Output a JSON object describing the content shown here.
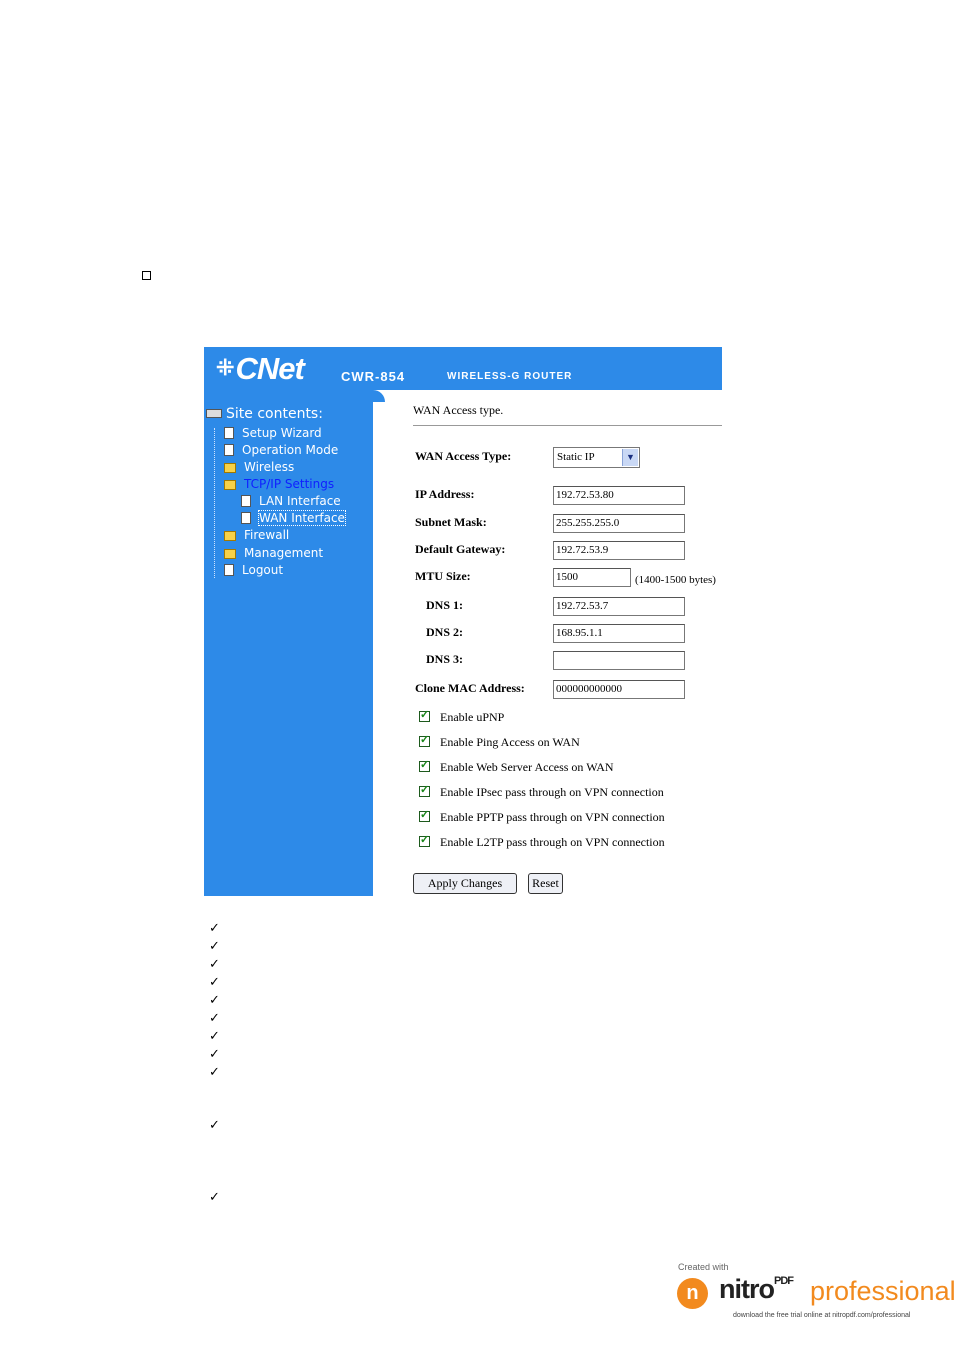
{
  "header": {
    "logo": "CNet",
    "model": "CWR-854",
    "product": "WIRELESS-G ROUTER"
  },
  "sidebar": {
    "root": "Site contents:",
    "items": [
      {
        "label": "Setup Wizard",
        "type": "doc"
      },
      {
        "label": "Operation Mode",
        "type": "doc"
      },
      {
        "label": "Wireless",
        "type": "folder"
      },
      {
        "label": "TCP/IP Settings",
        "type": "folder-open",
        "active": true
      },
      {
        "label": "LAN Interface",
        "type": "doc",
        "child": true
      },
      {
        "label": "WAN Interface",
        "type": "doc",
        "child": true
      },
      {
        "label": "Firewall",
        "type": "folder"
      },
      {
        "label": "Management",
        "type": "folder"
      },
      {
        "label": "Logout",
        "type": "doc"
      }
    ]
  },
  "form": {
    "section_title": "WAN Access type.",
    "wan_access_type_label": "WAN Access Type:",
    "wan_access_type_value": "Static IP",
    "ip_address_label": "IP Address:",
    "ip_address_value": "192.72.53.80",
    "subnet_mask_label": "Subnet Mask:",
    "subnet_mask_value": "255.255.255.0",
    "gateway_label": "Default Gateway:",
    "gateway_value": "192.72.53.9",
    "mtu_label": "MTU Size:",
    "mtu_value": "1500",
    "mtu_hint": "(1400-1500 bytes)",
    "dns1_label": "DNS 1:",
    "dns1_value": "192.72.53.7",
    "dns2_label": "DNS 2:",
    "dns2_value": "168.95.1.1",
    "dns3_label": "DNS 3:",
    "dns3_value": "",
    "clone_mac_label": "Clone MAC Address:",
    "clone_mac_value": "000000000000",
    "checkboxes": [
      "Enable uPNP",
      "Enable Ping Access on WAN",
      "Enable Web Server Access on WAN",
      "Enable IPsec pass through on VPN connection",
      "Enable PPTP pass through on VPN connection",
      "Enable L2TP pass through on VPN connection"
    ],
    "apply_label": "Apply Changes",
    "reset_label": "Reset"
  },
  "footer": {
    "created_with": "Created with",
    "brand": "nitro",
    "brand_sup": "PDF",
    "brand_suffix": "professional",
    "tagline": "download the free trial online at nitropdf.com/professional"
  },
  "colors": {
    "panel_blue": "#2d8ae8",
    "active_link": "#1020ff",
    "nitro_orange": "#f28a1e"
  }
}
